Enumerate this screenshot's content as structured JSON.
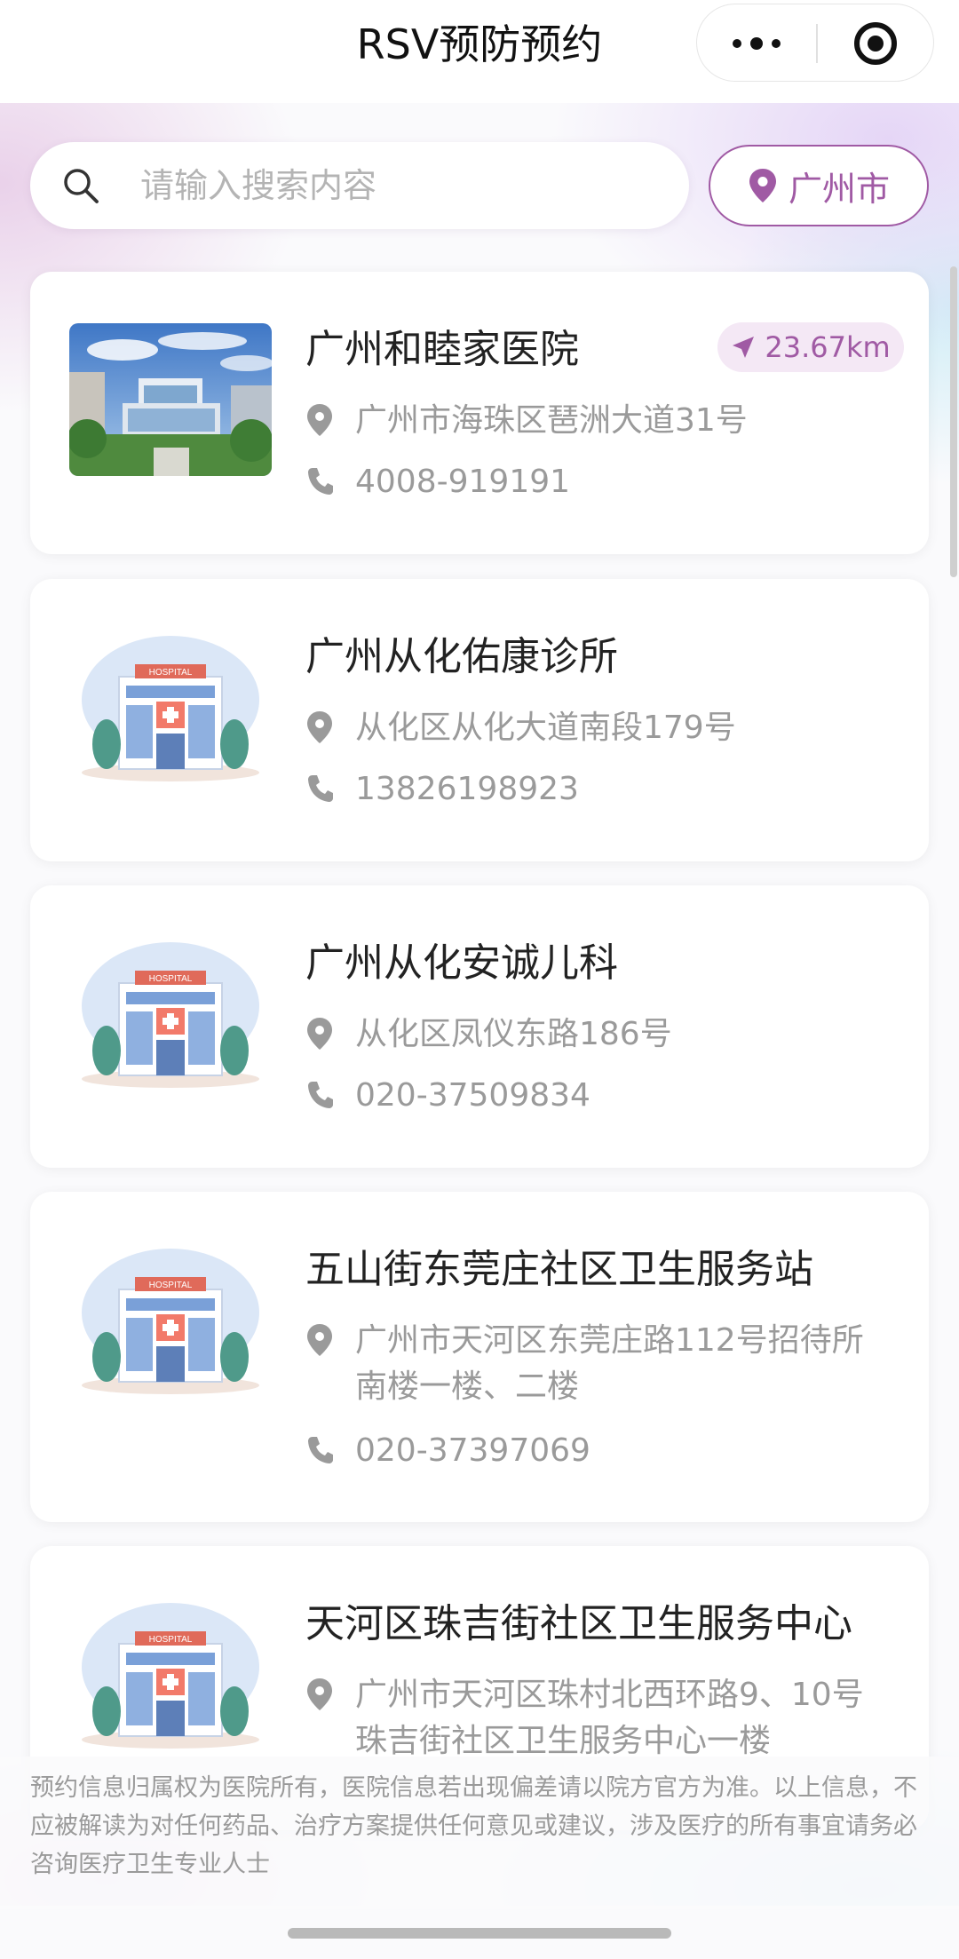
{
  "nav": {
    "title": "RSV预防预约",
    "more_icon": "more-dots-icon",
    "close_icon": "target-circle-icon"
  },
  "search": {
    "placeholder": "请输入搜索内容",
    "icon": "search-icon"
  },
  "location": {
    "city": "广州市",
    "icon": "location-pin-icon"
  },
  "clinics": [
    {
      "name": "广州和睦家医院",
      "distance": "23.67km",
      "address": "广州市海珠区琶洲大道31号",
      "phone": "4008-919191",
      "image": "hospital-photo"
    },
    {
      "name": "广州从化佑康诊所",
      "address": "从化区从化大道南段179号",
      "phone": "13826198923",
      "image": "hospital-illustration",
      "image_label": "HOSPITAL"
    },
    {
      "name": "广州从化安诚儿科",
      "address": "从化区凤仪东路186号",
      "phone": "020-37509834",
      "image": "hospital-illustration",
      "image_label": "HOSPITAL"
    },
    {
      "name": "五山街东莞庄社区卫生服务站",
      "address_line1": "广州市天河区东莞庄路112号招待所",
      "address_line2": "南楼一楼、二楼",
      "phone": "020-37397069",
      "image": "hospital-illustration",
      "image_label": "HOSPITAL"
    },
    {
      "name": "天河区珠吉街社区卫生服务中心",
      "address_line1": "广州市天河区珠村北西环路9、10号",
      "address_line2": "珠吉街社区卫生服务中心一楼",
      "image": "hospital-illustration",
      "image_label": "HOSPITAL"
    }
  ],
  "disclaimer": "预约信息归属权为医院所有，医院信息若出现偏差请以院方官方为准。以上信息，不应被解读为对任何药品、治疗方案提供任何意见或建议，涉及医疗的所有事宜请务必咨询医疗卫生专业人士",
  "colors": {
    "accent": "#a05aa4",
    "distance_bg": "#f4e8f5",
    "muted_text": "#9a9a9a",
    "title_text": "#222222"
  }
}
